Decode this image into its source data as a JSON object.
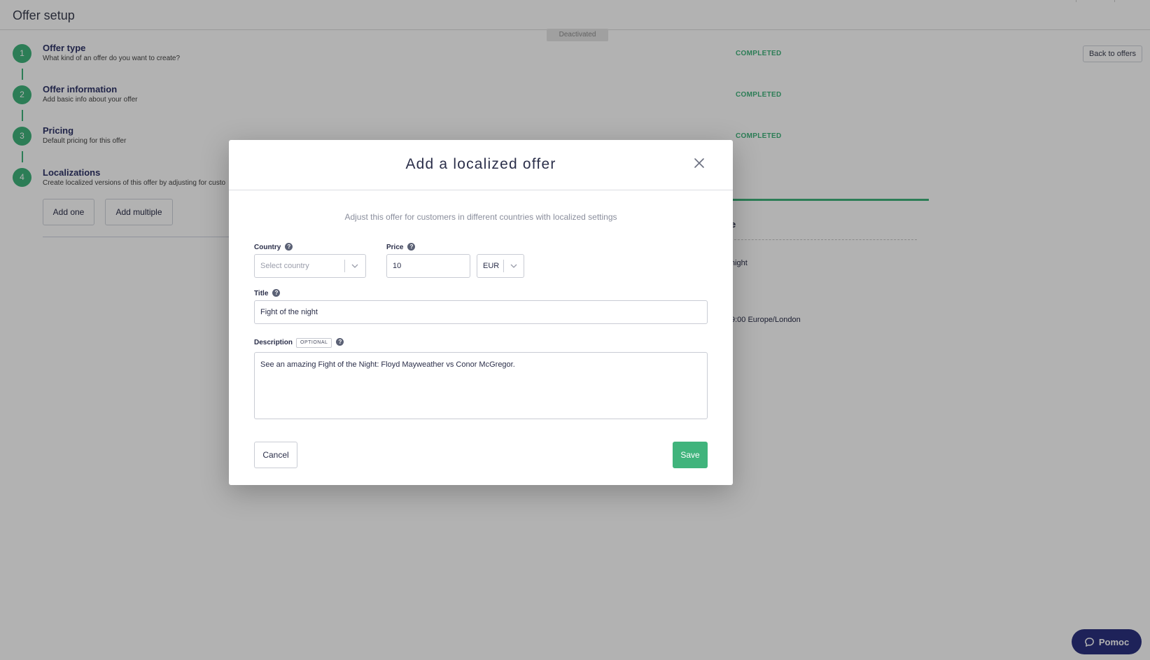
{
  "page": {
    "title": "Offer setup",
    "status_badge": "Deactivated",
    "back_button": "Back to offers",
    "steps": [
      {
        "number": "1",
        "title": "Offer type",
        "description": "What kind of an offer do you want to create?",
        "status": "COMPLETED"
      },
      {
        "number": "2",
        "title": "Offer information",
        "description": "Add basic info about your offer",
        "status": "COMPLETED"
      },
      {
        "number": "3",
        "title": "Pricing",
        "description": "Default pricing for this offer",
        "status": "COMPLETED"
      },
      {
        "number": "4",
        "title": "Localizations",
        "description": "Create localized versions of this offer by adjusting for custo",
        "status": ""
      }
    ],
    "add_one_button": "Add one",
    "add_multiple_button": "Add multiple",
    "side_card": {
      "heading_fragment": "e",
      "title_fragment": "night",
      "time_fragment": "9:00 Europe/London"
    },
    "help_button": "Pomoc"
  },
  "modal": {
    "title": "Add a localized offer",
    "subtitle": "Adjust this offer for customers in different countries with localized settings",
    "country": {
      "label": "Country",
      "placeholder": "Select country"
    },
    "price": {
      "label": "Price",
      "value": "10",
      "currency": "EUR"
    },
    "title_field": {
      "label": "Title",
      "value": "Fight of the night"
    },
    "description": {
      "label": "Description",
      "badge": "OPTIONAL",
      "value": "See an amazing Fight of the Night: Floyd Mayweather vs Conor McGregor."
    },
    "cancel_button": "Cancel",
    "save_button": "Save"
  },
  "colors": {
    "accent_green": "#40b47c",
    "navy": "#2b3280",
    "step_title": "#2f3468"
  },
  "icons": [
    "close-icon",
    "help-icon",
    "chevron-down-icon",
    "chat-bubble-icon"
  ]
}
